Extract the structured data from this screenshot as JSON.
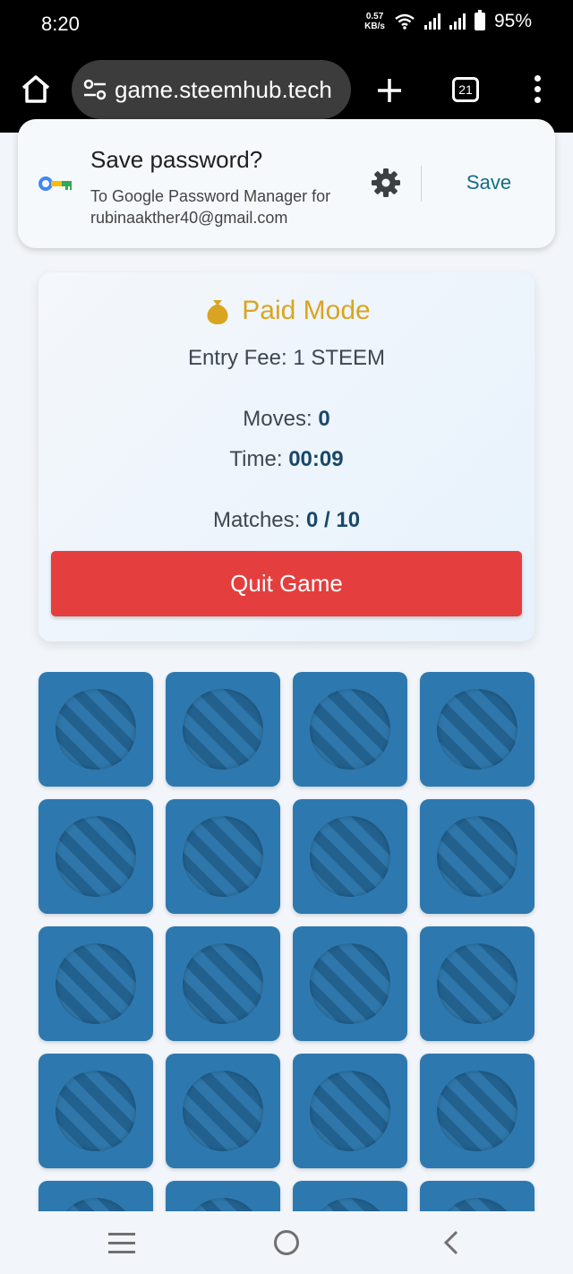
{
  "status_bar": {
    "time": "8:20",
    "net_speed_value": "0.57",
    "net_speed_unit": "KB/s",
    "battery": "95%"
  },
  "browser": {
    "url": "game.steemhub.tech",
    "tab_count": "21"
  },
  "password_prompt": {
    "title": "Save password?",
    "subtitle": "To Google Password Manager for rubinaakther40@gmail.com",
    "save_label": "Save"
  },
  "game": {
    "mode_title": "Paid Mode",
    "entry_fee": "Entry Fee: 1 STEEM",
    "moves_label": "Moves: ",
    "moves_value": "0",
    "time_label": "Time: ",
    "time_value": "00:09",
    "matches_label": "Matches: ",
    "matches_value": "0 / 10",
    "quit_label": "Quit Game"
  },
  "colors": {
    "accent_gold": "#d9a520",
    "quit_red": "#e43e3e",
    "card_blue": "#2d79af",
    "value_navy": "#17486a",
    "save_teal": "#136c86"
  },
  "icons": {
    "home": "home-icon",
    "site_settings": "tune-icon",
    "new_tab": "plus-icon",
    "menu": "more-vert-icon",
    "key": "key-icon",
    "settings": "gear-icon",
    "mode": "money-bag-icon",
    "card_back": "striped-disc-icon"
  }
}
